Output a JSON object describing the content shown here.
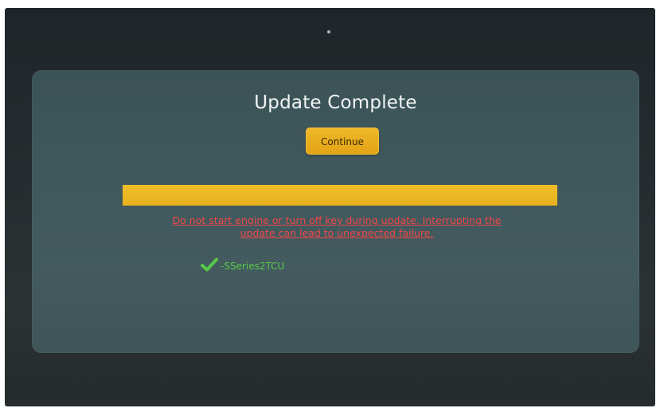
{
  "dialog": {
    "title": "Update Complete",
    "continue_label": "Continue"
  },
  "progress": {
    "fraction": 1.0
  },
  "warning": {
    "line1": "Do not start engine or turn off key during update. Interrupting the",
    "line2": "update can lead to unexpected failure."
  },
  "modules": [
    {
      "status_icon": "check-icon",
      "label": "-SSeries2TCU"
    }
  ],
  "colors": {
    "accent": "#e8b21e",
    "warning": "#f1464a",
    "success": "#58c84a",
    "panel": "#3f585c"
  }
}
